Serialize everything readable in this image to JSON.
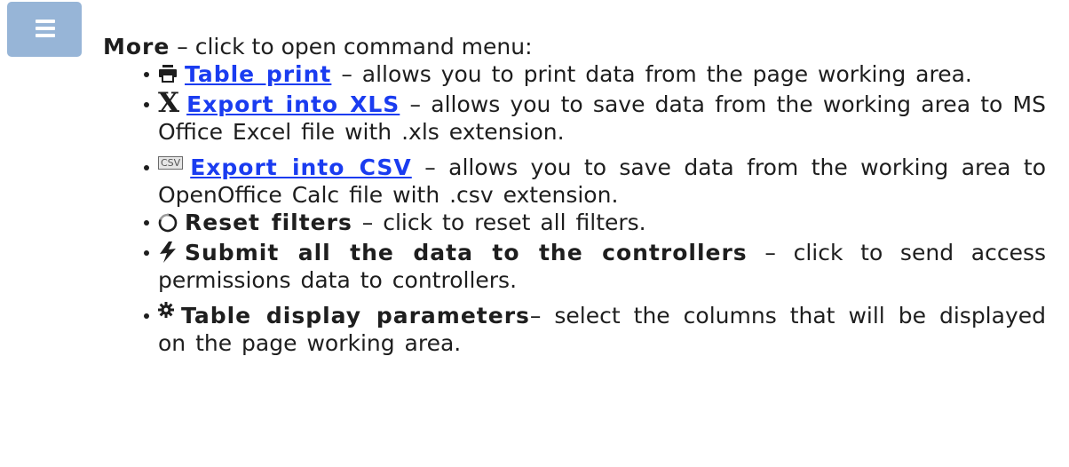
{
  "more": {
    "label": "More",
    "description": " – click to open command menu:"
  },
  "items": [
    {
      "icon": "printer-icon",
      "title": "Table print",
      "description": " – allows you to print data from the page working area."
    },
    {
      "icon": "excel-x-icon",
      "glyph": "X",
      "title": "Export into XLS",
      "description": " – allows you to save data from the working area to MS Office Excel file with .xls extension."
    },
    {
      "icon": "csv-icon",
      "glyph": "CSV",
      "title": "Export into CSV",
      "description": " – allows you to save data from the working area to OpenOffice Calc file with .csv extension."
    },
    {
      "icon": "reset-icon",
      "title": "Reset filters",
      "description": " – click to reset all filters."
    },
    {
      "icon": "lightning-icon",
      "title": "Submit all the data to the controllers",
      "description": " – click to send access permissions data to controllers."
    },
    {
      "icon": "gear-icon",
      "title": "Table display parameters",
      "description": "– select the columns that will be displayed on the page working area."
    }
  ],
  "colors": {
    "link": "#1a3cf0",
    "menu_icon_bg": "#97b5d7",
    "text": "#1e1e1e"
  }
}
